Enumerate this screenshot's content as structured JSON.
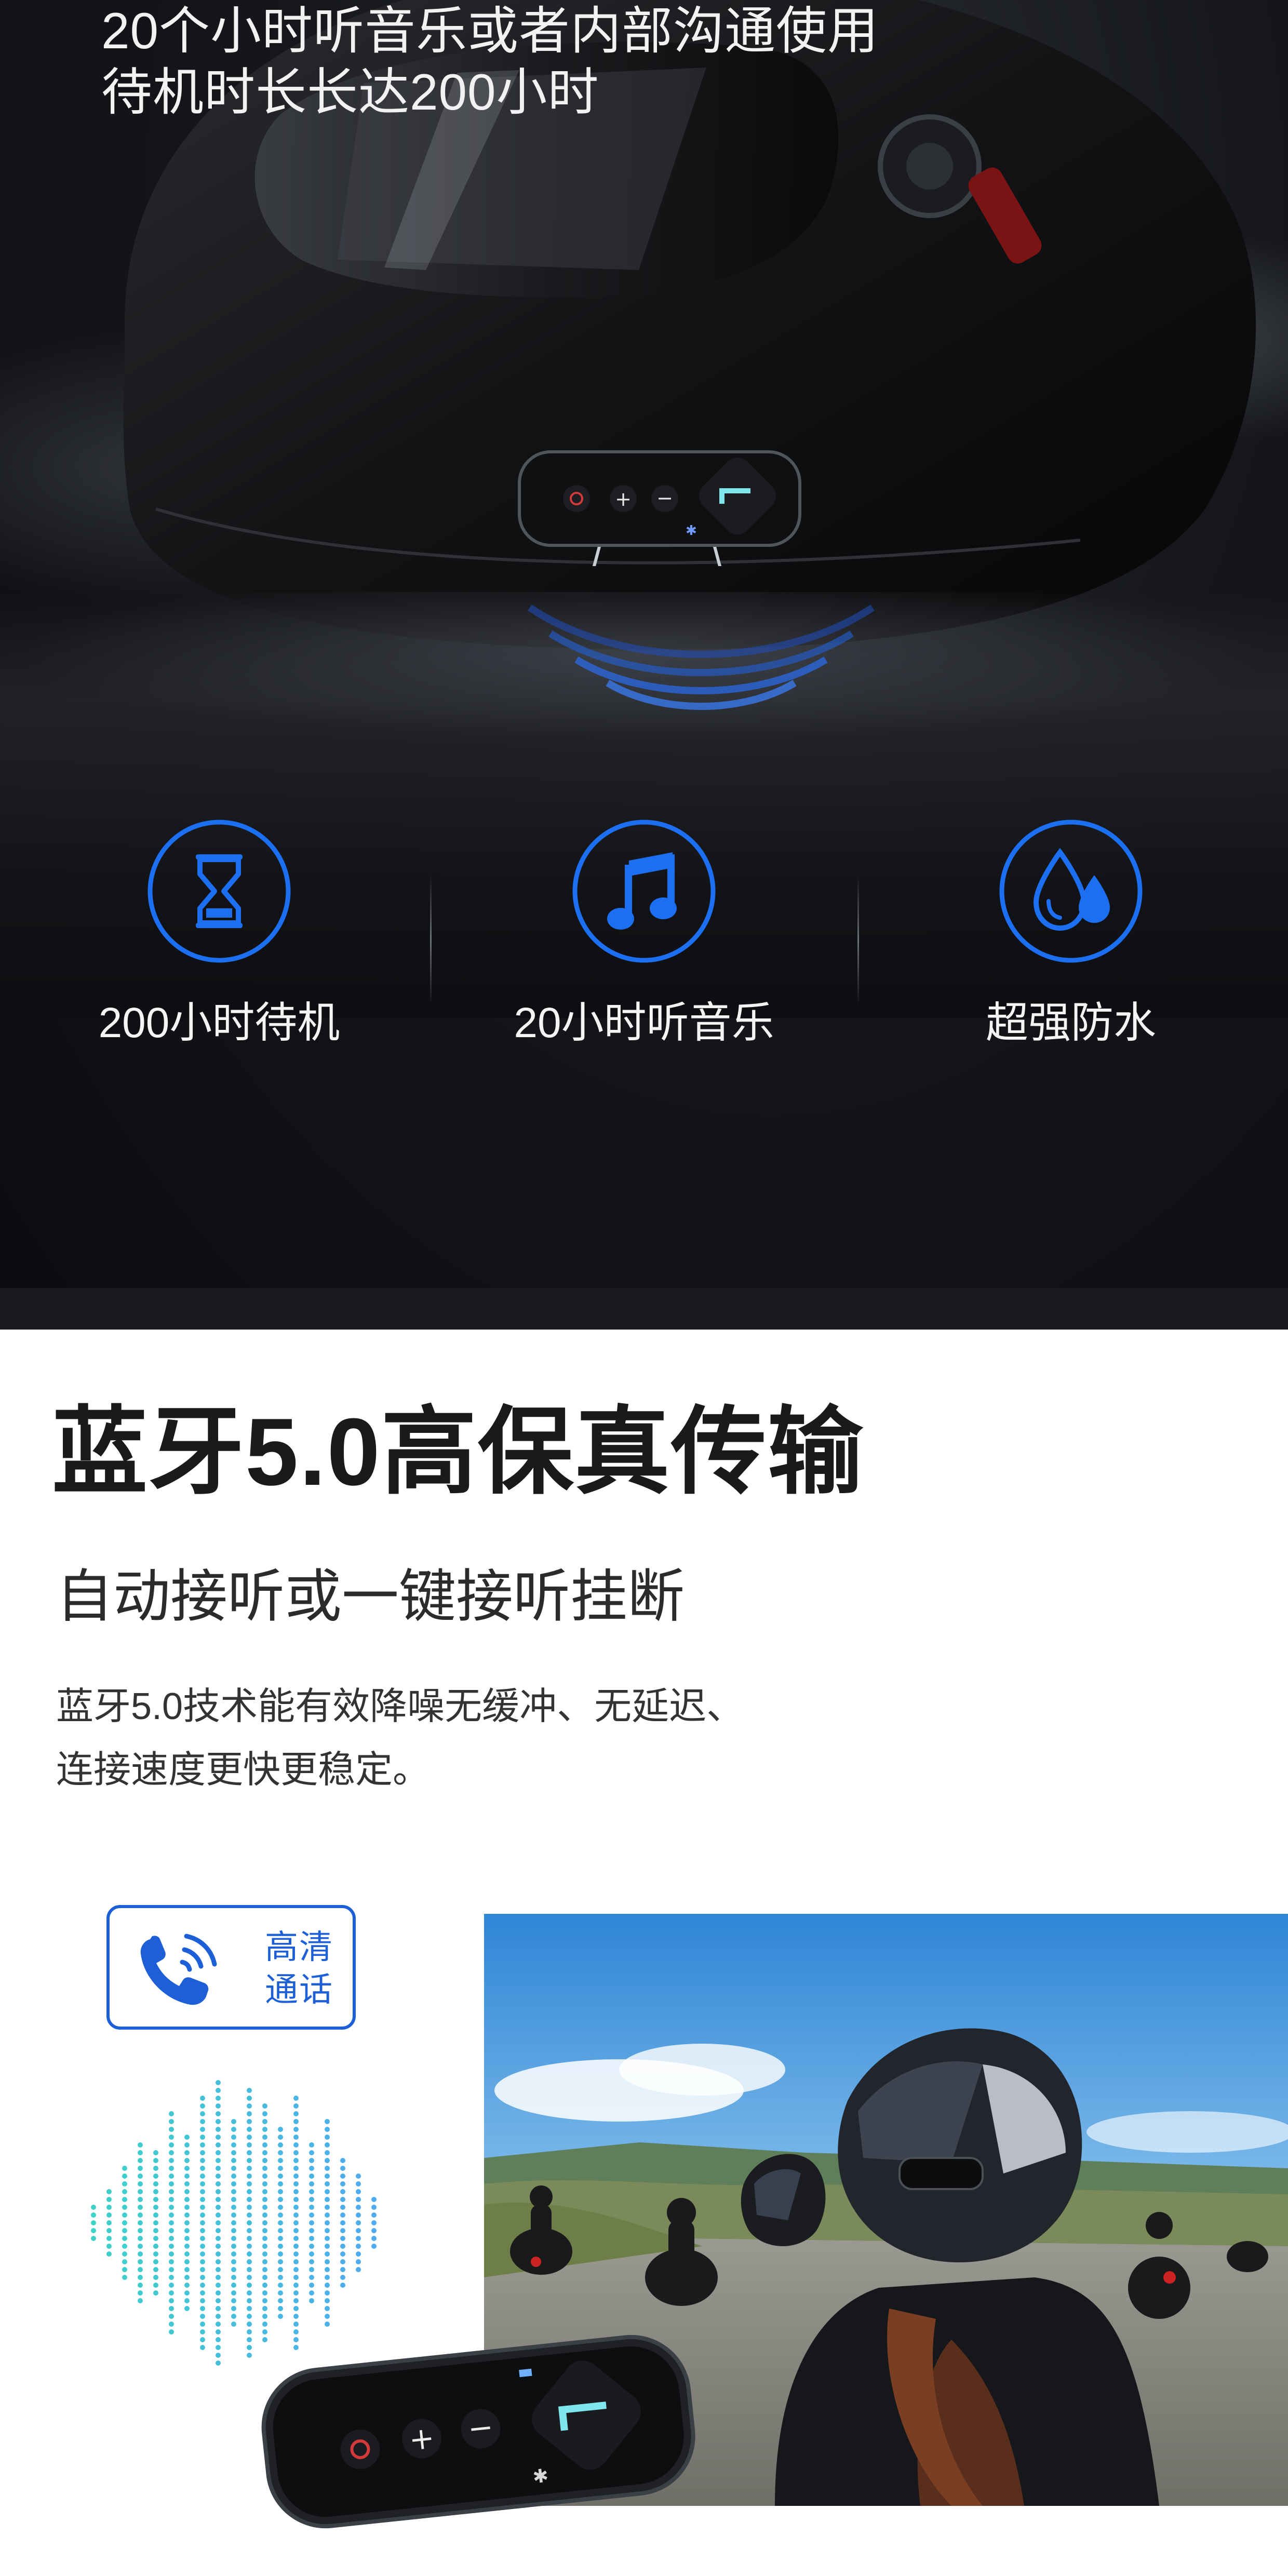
{
  "hero": {
    "headline_line1": "20个小时听音乐或者内部沟通使用",
    "headline_line2": "待机时长长达200小时",
    "features": [
      {
        "icon": "hourglass-icon",
        "label": "200小时待机"
      },
      {
        "icon": "music-note-icon",
        "label": "20小时听音乐"
      },
      {
        "icon": "water-drop-icon",
        "label": "超强防水"
      }
    ],
    "accent": "#1b6ff0"
  },
  "section": {
    "title": "蓝牙5.0高保真传输",
    "subtitle": "自动接听或一键接听挂断",
    "desc_line1": "蓝牙5.0技术能有效降噪无缓冲、无延迟、",
    "desc_line2": "连接速度更快更稳定。",
    "badge": {
      "icon": "phone-call-icon",
      "line1": "高清",
      "line2": "通话"
    },
    "accent": "#1d5fd6"
  }
}
